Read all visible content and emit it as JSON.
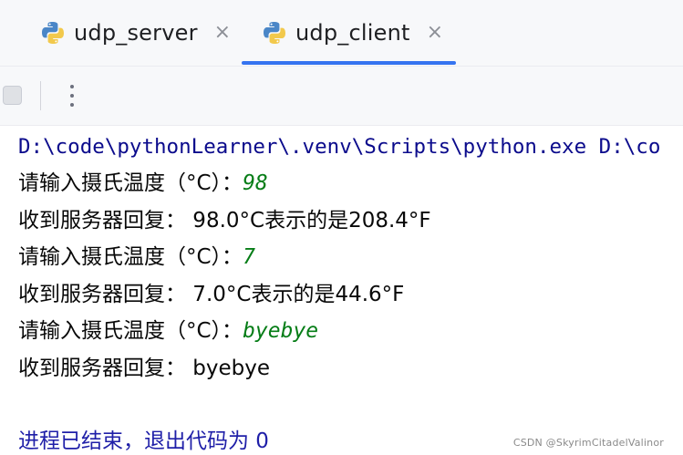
{
  "tabs": [
    {
      "label": "udp_server",
      "icon": "python-icon",
      "active": false
    },
    {
      "label": "udp_client",
      "icon": "python-icon",
      "active": true
    }
  ],
  "tab_close_glyph": "×",
  "colors": {
    "accent": "#3574f0",
    "command": "#0b0b8c",
    "user_input": "#067d17",
    "exit": "#1f1fa8"
  },
  "console": {
    "command": "D:\\code\\pythonLearner\\.venv\\Scripts\\python.exe D:\\co",
    "prompt_label": "请输入摄氏温度（°C）：",
    "reply_label": "收到服务器回复：",
    "inputs": [
      "98",
      "7",
      "byebye"
    ],
    "replies": [
      " 98.0°C表示的是208.4°F",
      " 7.0°C表示的是44.6°F",
      " byebye"
    ],
    "exit_message": "进程已结束，退出代码为 0"
  },
  "watermark": "CSDN @SkyrimCitadelValinor"
}
